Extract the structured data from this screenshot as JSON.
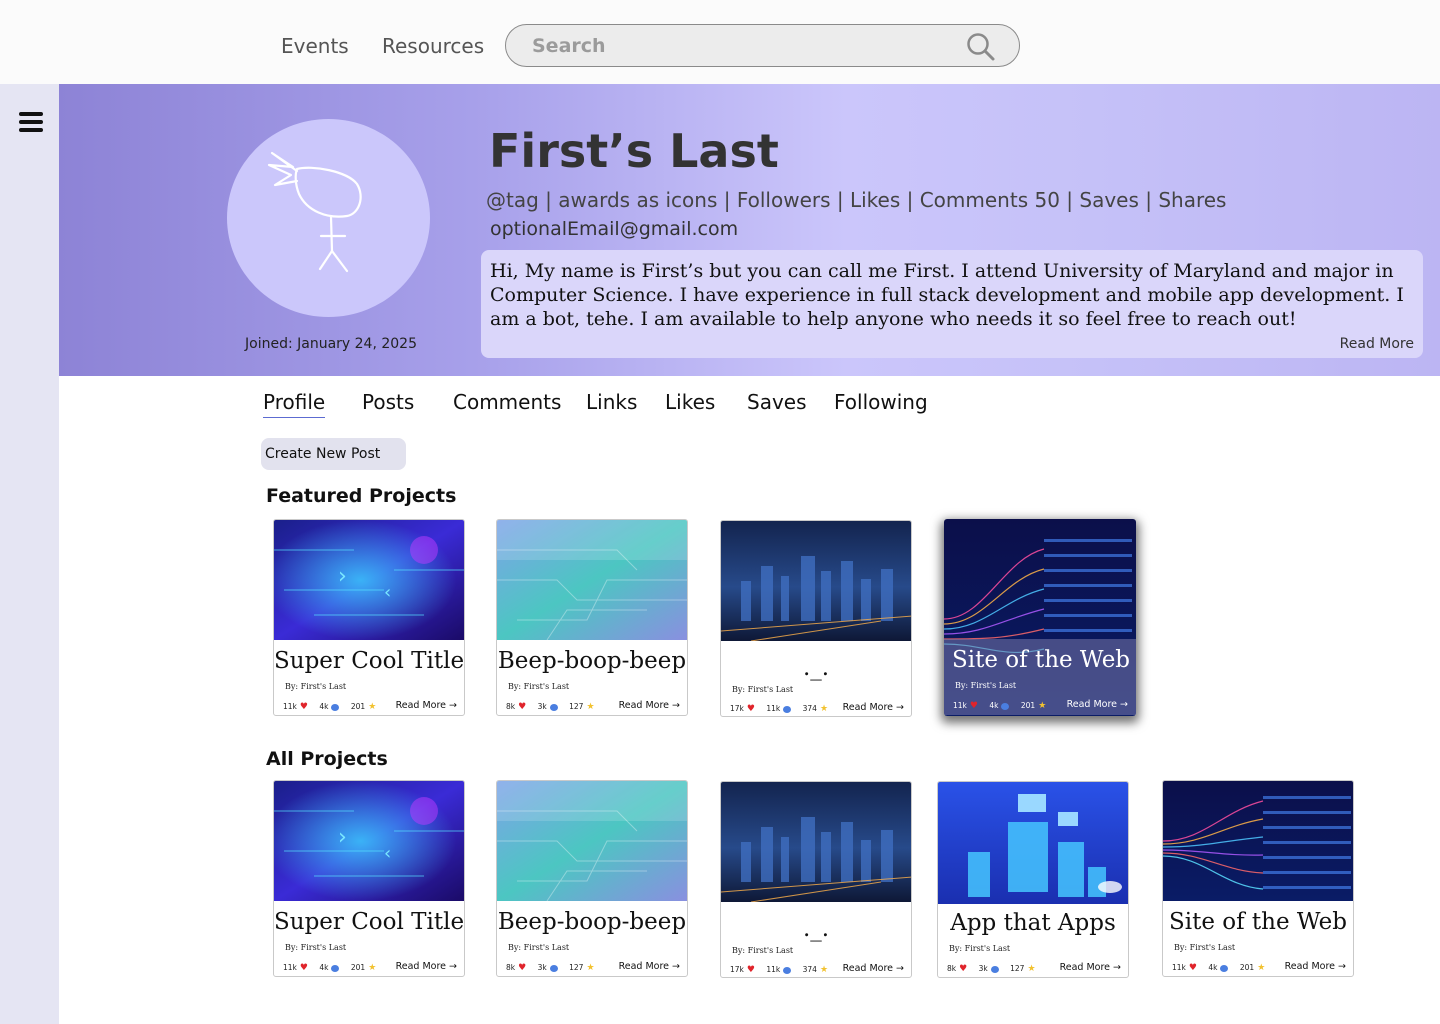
{
  "nav": {
    "events": "Events",
    "resources": "Resources",
    "search_placeholder": "Search"
  },
  "profile": {
    "name": "First’s Last",
    "stats_line": "@tag | awards as icons | Followers | Likes | Comments 50  | Saves | Shares",
    "email": "optionalEmail@gmail.com",
    "bio": "Hi, My name is First’s but you can call me First. I attend University of Maryland and major in Computer Science. I have experience in full stack development and mobile app development. I am a bot, tehe. I am available to help anyone who needs it so feel free to reach out!",
    "bio_read_more": "Read More",
    "joined": "Joined: January 24, 2025"
  },
  "tabs": [
    "Profile",
    "Posts",
    "Comments",
    "Links",
    "Likes",
    "Saves",
    "Following"
  ],
  "create_button": "Create New Post",
  "sections": {
    "featured": "Featured Projects",
    "all": "All Projects"
  },
  "featured_cards": [
    {
      "title": "Super Cool Title",
      "author": "By: First's Last",
      "likes": "11k",
      "comments": "4k",
      "stars": "201",
      "more": "Read More →"
    },
    {
      "title": "Beep-boop-beep",
      "author": "By: First's Last",
      "likes": "8k",
      "comments": "3k",
      "stars": "127",
      "more": "Read More →"
    },
    {
      "title": "._.",
      "author": "By: First's Last",
      "likes": "17k",
      "comments": "11k",
      "stars": "374",
      "more": "Read More →"
    },
    {
      "title": "Site of the Web",
      "author": "By: First's Last",
      "likes": "11k",
      "comments": "4k",
      "stars": "201",
      "more": "Read More →"
    }
  ],
  "all_cards": [
    {
      "title": "Super Cool Title",
      "author": "By: First's Last",
      "likes": "11k",
      "comments": "4k",
      "stars": "201",
      "more": "Read More →"
    },
    {
      "title": "Beep-boop-beep",
      "author": "By: First's Last",
      "likes": "8k",
      "comments": "3k",
      "stars": "127",
      "more": "Read More →"
    },
    {
      "title": "._.",
      "author": "By: First's Last",
      "likes": "17k",
      "comments": "11k",
      "stars": "374",
      "more": "Read More →"
    },
    {
      "title": "App that Apps",
      "author": "By: First's Last",
      "likes": "8k",
      "comments": "3k",
      "stars": "127",
      "more": "Read More →"
    },
    {
      "title": "Site of the Web",
      "author": "By: First's Last",
      "likes": "11k",
      "comments": "4k",
      "stars": "201",
      "more": "Read More →"
    }
  ]
}
